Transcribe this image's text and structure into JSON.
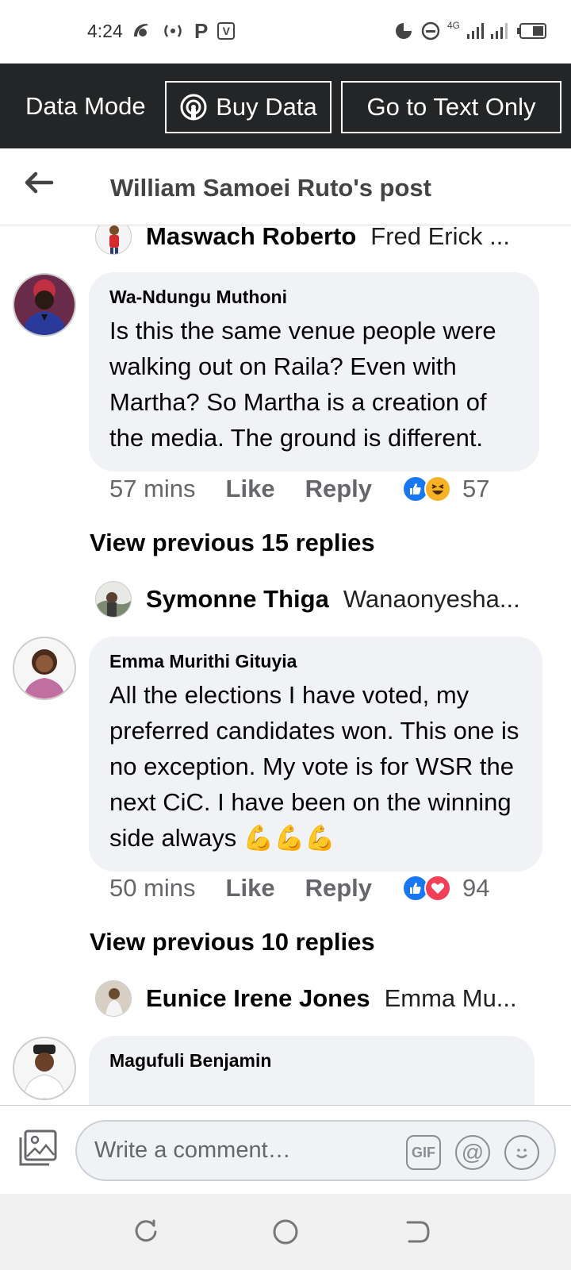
{
  "status_bar": {
    "time": "4:24",
    "network": "4G"
  },
  "data_mode": {
    "label": "Data Mode",
    "buy_label": "Buy Data",
    "text_only_label": "Go to Text Only"
  },
  "header": {
    "title": "William Samoei Ruto's post"
  },
  "thread": {
    "preview_1": {
      "name": "Maswach Roberto",
      "text": "Fred Erick ..."
    },
    "comment_1": {
      "author": "Wa-Ndungu Muthoni",
      "text": "Is this the same venue people were walking out on Raila? Even with Martha? So Martha is a creation of the media. The ground is different.",
      "time": "57 mins",
      "like": "Like",
      "reply": "Reply",
      "reaction_count": "57",
      "reactions": [
        "like",
        "haha"
      ]
    },
    "view_prev_1": "View previous 15 replies",
    "preview_2": {
      "name": "Symonne Thiga",
      "text": "Wanaonyesha..."
    },
    "comment_2": {
      "author": "Emma Murithi Gituyia",
      "text": "All the elections I have voted, my preferred candidates won. This one is no exception. My vote is for WSR the next CiC. I have been on the winning side always",
      "emoji": "💪💪💪",
      "time": "50 mins",
      "like": "Like",
      "reply": "Reply",
      "reaction_count": "94",
      "reactions": [
        "like",
        "love"
      ]
    },
    "view_prev_2": "View previous 10 replies",
    "preview_3": {
      "name": "Eunice Irene Jones",
      "text": "Emma Mu..."
    },
    "comment_3": {
      "author": "Magufuli Benjamin"
    }
  },
  "composer": {
    "placeholder": "Write a comment…",
    "gif_label": "GIF",
    "at_label": "@"
  },
  "colors": {
    "data_bar": "#242526",
    "bubble": "#f0f2f5",
    "like_blue": "#1877f2",
    "love_red": "#f33e58",
    "haha_yellow": "#f7b125"
  }
}
